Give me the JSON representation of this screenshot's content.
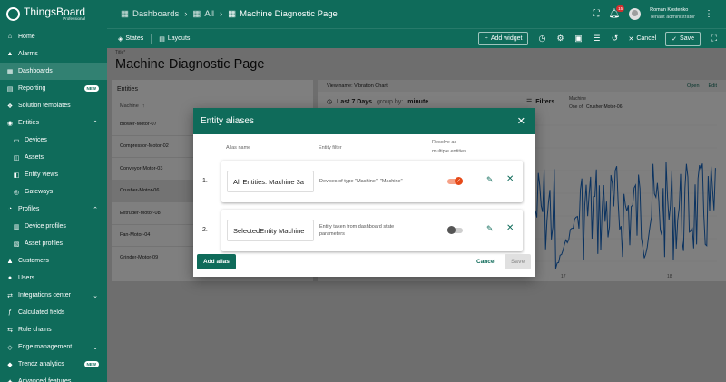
{
  "app": {
    "brand": "ThingsBoard",
    "brand_sub": "Professional"
  },
  "breadcrumbs": [
    {
      "label": "Dashboards"
    },
    {
      "label": "All"
    },
    {
      "label": "Machine Diagnostic Page"
    }
  ],
  "user": {
    "name": "Roman Kostenko",
    "role": "Tenant administrator",
    "notifications": "15"
  },
  "sidebar": {
    "items": [
      {
        "label": "Home",
        "icon": "home-icon"
      },
      {
        "label": "Alarms",
        "icon": "alarm-icon"
      },
      {
        "label": "Dashboards",
        "icon": "dashboard-icon",
        "active": true
      },
      {
        "label": "Reporting",
        "icon": "report-icon",
        "badge": "NEW"
      },
      {
        "label": "Solution templates",
        "icon": "templates-icon"
      },
      {
        "label": "Entities",
        "icon": "entities-icon",
        "expanded": true
      },
      {
        "label": "Devices",
        "icon": "device-icon",
        "sub": true
      },
      {
        "label": "Assets",
        "icon": "asset-icon",
        "sub": true
      },
      {
        "label": "Entity views",
        "icon": "entity-view-icon",
        "sub": true
      },
      {
        "label": "Gateways",
        "icon": "gateway-icon",
        "sub": true
      },
      {
        "label": "Profiles",
        "icon": "profiles-icon",
        "expanded": true
      },
      {
        "label": "Device profiles",
        "icon": "device-profile-icon",
        "sub": true
      },
      {
        "label": "Asset profiles",
        "icon": "asset-profile-icon",
        "sub": true
      },
      {
        "label": "Customers",
        "icon": "customers-icon"
      },
      {
        "label": "Users",
        "icon": "users-icon"
      },
      {
        "label": "Integrations center",
        "icon": "integrations-icon",
        "collapsed": true
      },
      {
        "label": "Calculated fields",
        "icon": "calculated-icon"
      },
      {
        "label": "Rule chains",
        "icon": "rule-chain-icon"
      },
      {
        "label": "Edge management",
        "icon": "edge-icon",
        "collapsed": true
      },
      {
        "label": "Trendz analytics",
        "icon": "trendz-icon",
        "badge": "NEW"
      },
      {
        "label": "Advanced features",
        "icon": "advanced-icon",
        "collapsed": true
      }
    ]
  },
  "toolbar": {
    "states_label": "States",
    "layouts_label": "Layouts",
    "add_widget_label": "Add widget",
    "cancel_label": "Cancel",
    "save_label": "Save"
  },
  "dashboard": {
    "title_label": "Title*",
    "title": "Machine Diagnostic Page",
    "entities_panel": {
      "header": "Entities",
      "column": "Machine",
      "rows": [
        "Blower-Motor-07",
        "Compressor-Motor-02",
        "Conveyor-Motor-03",
        "Crusher-Motor-06",
        "Extruder-Motor-08",
        "Fan-Motor-04",
        "Grinder-Motor-09"
      ],
      "selected": "Crusher-Motor-06"
    },
    "chart_panel": {
      "view_name": "View name: Vibration Chart",
      "open_label": "Open",
      "edit_label": "Edit",
      "time_window": "Last 7 Days",
      "group_by_label": "group by:",
      "group_by_value": "minute",
      "filters_label": "Filters",
      "filter_entity": "Machine",
      "filter_op": "One of",
      "filter_value": "Crusher-Motor-06",
      "x_ticks": [
        "17",
        "18"
      ]
    }
  },
  "modal": {
    "title": "Entity aliases",
    "col_alias_name": "Alias name",
    "col_entity_filter": "Entity filter",
    "col_resolve_line1": "Resolve as",
    "col_resolve_line2": "multiple entities",
    "aliases": [
      {
        "num": "1.",
        "name": "All Entities: Machine 3a",
        "filter_line1": "Devices of type \"Machine\", \"Machine\"",
        "filter_line2": "",
        "resolve_multiple": true
      },
      {
        "num": "2.",
        "name": "SelectedEntity Machine",
        "filter_line1": "Entity taken from dashboard state",
        "filter_line2": "parameters",
        "resolve_multiple": false
      }
    ],
    "add_alias_label": "Add alias",
    "cancel_label": "Cancel",
    "save_label": "Save"
  },
  "colors": {
    "primary": "#0f6b5a",
    "toggle_on": "#e64a19",
    "chart_line": "#1565c0"
  }
}
